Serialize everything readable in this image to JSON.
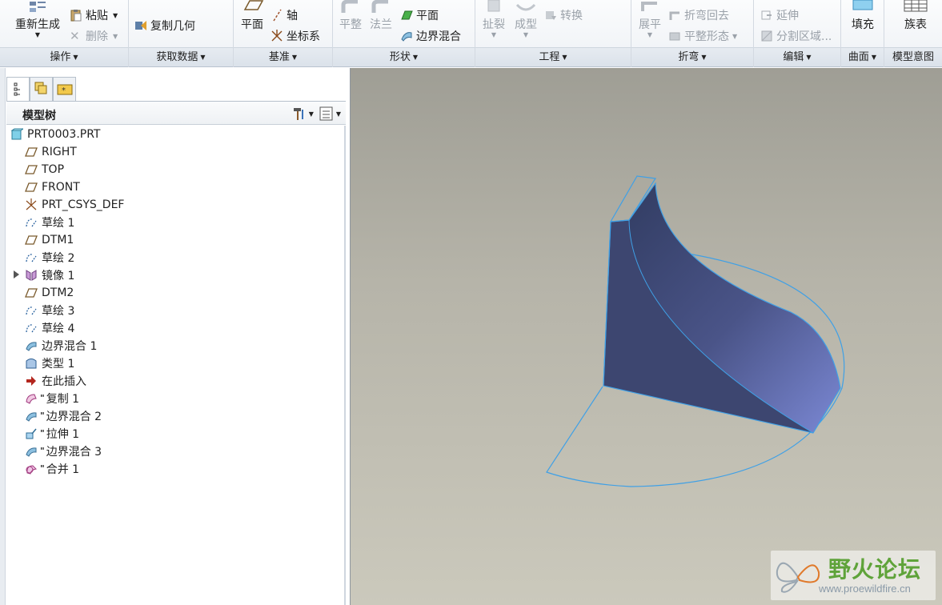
{
  "ribbon": {
    "groups": [
      {
        "label": "操作",
        "buttons": {
          "regenerate": "重新生成",
          "paste": "粘贴",
          "delete": "删除"
        }
      },
      {
        "label": "获取数据",
        "buttons": {
          "copy_geometry": "复制几何"
        }
      },
      {
        "label": "基准",
        "buttons": {
          "plane": "平面",
          "axis": "轴",
          "csys": "坐标系"
        }
      },
      {
        "label": "形状",
        "buttons": {
          "flat": "平整",
          "flange": "法兰",
          "plane": "平面",
          "boundary_blend": "边界混合"
        }
      },
      {
        "label": "工程",
        "buttons": {
          "rip": "扯裂",
          "form": "成型",
          "convert": "转换"
        }
      },
      {
        "label": "折弯",
        "buttons": {
          "unbend": "展平",
          "bend_back": "折弯回去",
          "flatten_form": "平整形态"
        }
      },
      {
        "label": "编辑",
        "buttons": {
          "extend": "延伸",
          "split_area": "分割区域..."
        }
      },
      {
        "label": "曲面",
        "buttons": {
          "fill": "填充"
        }
      },
      {
        "label": "模型意图",
        "buttons": {
          "family_table": "族表"
        }
      }
    ]
  },
  "panel": {
    "title": "模型树",
    "tabs": [
      "model-tree",
      "layers",
      "favorites"
    ]
  },
  "tree": {
    "items": [
      {
        "label": "PRT0003.PRT",
        "icon": "part-icon",
        "mark": ""
      },
      {
        "label": "RIGHT",
        "icon": "datum-plane-icon",
        "mark": ""
      },
      {
        "label": "TOP",
        "icon": "datum-plane-icon",
        "mark": ""
      },
      {
        "label": "FRONT",
        "icon": "datum-plane-icon",
        "mark": ""
      },
      {
        "label": "PRT_CSYS_DEF",
        "icon": "csys-icon",
        "mark": ""
      },
      {
        "label": "草绘 1",
        "icon": "sketch-icon",
        "mark": ""
      },
      {
        "label": "DTM1",
        "icon": "datum-plane-icon",
        "mark": ""
      },
      {
        "label": "草绘 2",
        "icon": "sketch-icon",
        "mark": ""
      },
      {
        "label": "镜像 1",
        "icon": "mirror-icon",
        "mark": ""
      },
      {
        "label": "DTM2",
        "icon": "datum-plane-icon",
        "mark": ""
      },
      {
        "label": "草绘 3",
        "icon": "sketch-icon",
        "mark": ""
      },
      {
        "label": "草绘 4",
        "icon": "sketch-icon",
        "mark": ""
      },
      {
        "label": "边界混合 1",
        "icon": "boundary-blend-icon",
        "mark": ""
      },
      {
        "label": "类型 1",
        "icon": "type-icon",
        "mark": ""
      },
      {
        "label": "在此插入",
        "icon": "insert-here-icon",
        "mark": ""
      },
      {
        "label": "复制 1",
        "icon": "copy-icon",
        "mark": "\""
      },
      {
        "label": "边界混合 2",
        "icon": "boundary-blend-icon",
        "mark": "\""
      },
      {
        "label": "拉伸 1",
        "icon": "extrude-icon",
        "mark": "\""
      },
      {
        "label": "边界混合 3",
        "icon": "boundary-blend-icon",
        "mark": "\""
      },
      {
        "label": "合并 1",
        "icon": "merge-icon",
        "mark": "\""
      }
    ]
  },
  "watermark": {
    "title": "野火论坛",
    "url": "www.proewildfire.cn"
  },
  "colors": {
    "surface_dark": "#2f3a5e",
    "surface_light": "#7b88d4",
    "edge": "#3fa0e6"
  }
}
